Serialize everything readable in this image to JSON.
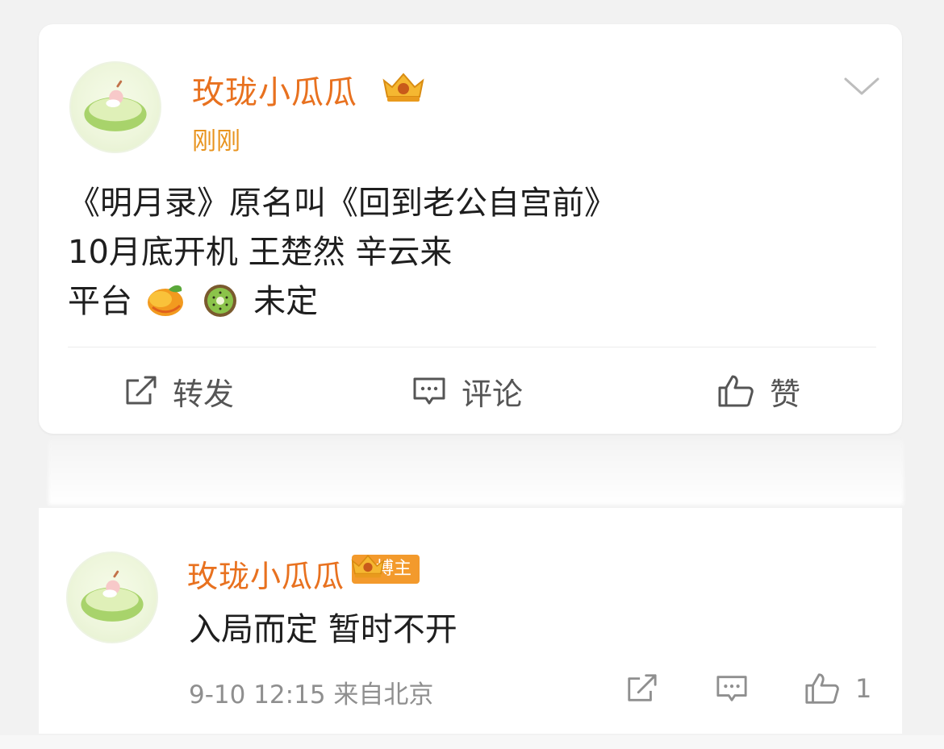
{
  "post": {
    "author": "玫珑小瓜瓜",
    "time": "刚刚",
    "lines": [
      "《明月录》原名叫《回到老公自宫前》",
      "10月底开机 王楚然 辛云来"
    ],
    "line3_prefix": "平台",
    "line3_suffix": "未定",
    "emojis": [
      "mango-emoji",
      "kiwi-emoji"
    ],
    "actions": {
      "repost": "转发",
      "comment": "评论",
      "like": "赞"
    }
  },
  "comment": {
    "author": "玫珑小瓜瓜",
    "badge": "博主",
    "text": "入局而定 暂时不开",
    "meta": "9-10 12:15  来自北京",
    "like_count": "1"
  },
  "colors": {
    "author_orange": "#e8711f",
    "badge_orange": "#f39a2c",
    "muted_gray": "#8f8f8f"
  }
}
